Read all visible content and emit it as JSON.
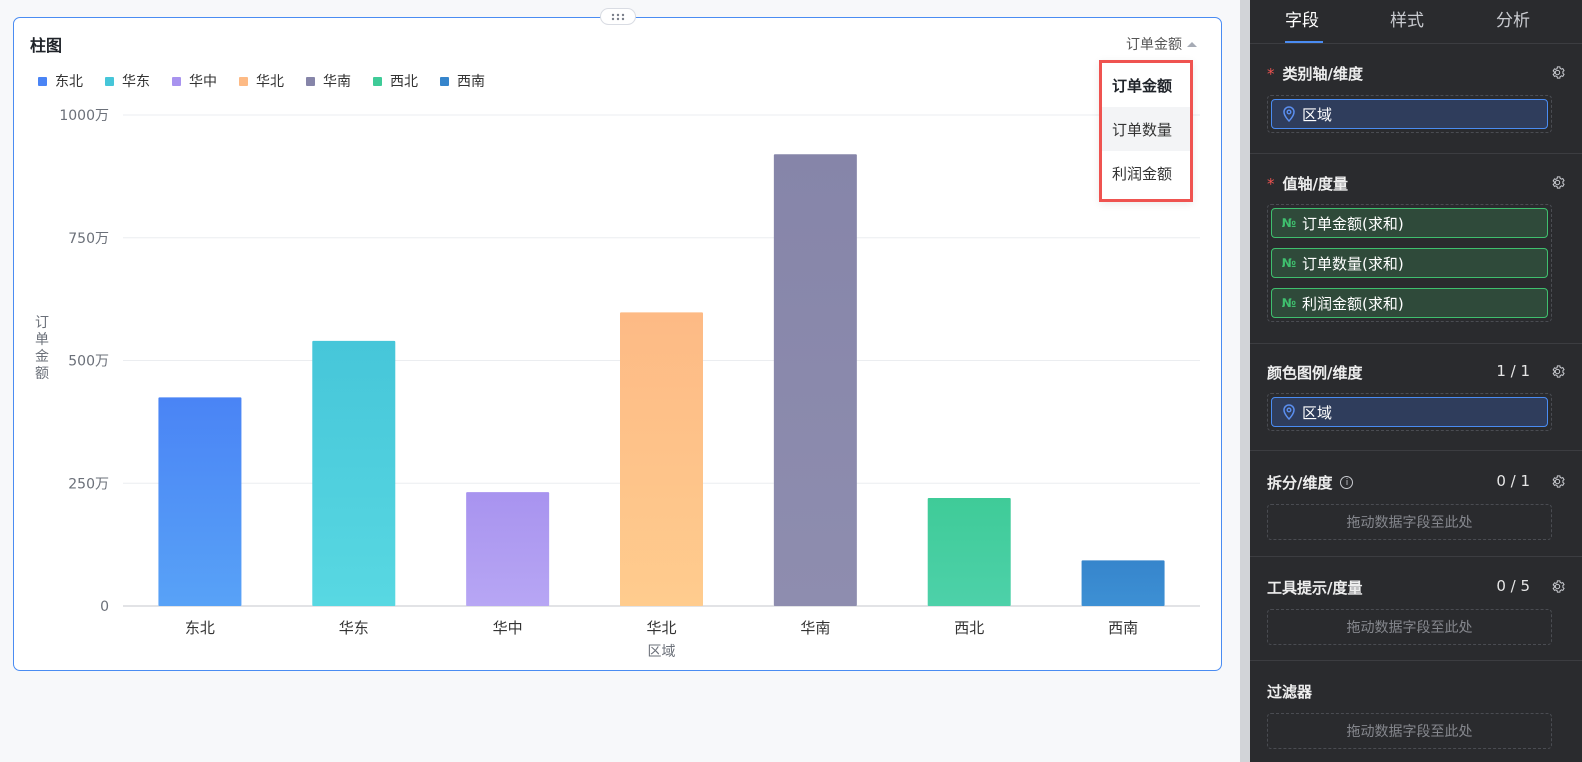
{
  "chart_title": "柱图",
  "measure_switch": {
    "current": "订单金额"
  },
  "dropdown": {
    "options": [
      "订单金额",
      "订单数量",
      "利润金额"
    ],
    "selected_index": 0,
    "hover_index": 1
  },
  "chart_data": {
    "type": "bar",
    "categories": [
      "东北",
      "华东",
      "华中",
      "华北",
      "华南",
      "西北",
      "西南"
    ],
    "values": [
      4250000,
      5400000,
      2320000,
      5980000,
      9200000,
      2200000,
      930000
    ],
    "colors_top": [
      "#4a84f5",
      "#46c6d9",
      "#a893ef",
      "#fdba85",
      "#8685a9",
      "#3fcb98",
      "#3685cc"
    ],
    "colors_bottom": [
      "#58a2f7",
      "#58d8e2",
      "#b7a6f4",
      "#ffcc8e",
      "#8e8daf",
      "#4dd1a9",
      "#3d90d4"
    ],
    "yticks": [
      "0",
      "250万",
      "500万",
      "750万",
      "1000万"
    ],
    "ylim": [
      0,
      10000000
    ],
    "ylabel": "订单金额",
    "xlabel": "区域",
    "grid": true,
    "legend_position": "top-left"
  },
  "panel": {
    "tabs": [
      "字段",
      "样式",
      "分析"
    ],
    "active_tab": 0,
    "sections": {
      "category": {
        "title": "类别轴/维度",
        "required": true,
        "fields": [
          "区域"
        ]
      },
      "value": {
        "title": "值轴/度量",
        "required": true,
        "fields": [
          "订单金额(求和)",
          "订单数量(求和)",
          "利润金额(求和)"
        ]
      },
      "color": {
        "title": "颜色图例/维度",
        "count": "1 / 1",
        "fields": [
          "区域"
        ]
      },
      "split": {
        "title": "拆分/维度",
        "count": "0 / 1",
        "placeholder": "拖动数据字段至此处"
      },
      "tooltip": {
        "title": "工具提示/度量",
        "count": "0 / 5",
        "placeholder": "拖动数据字段至此处"
      },
      "filter": {
        "title": "过滤器",
        "placeholder": "拖动数据字段至此处"
      }
    }
  }
}
